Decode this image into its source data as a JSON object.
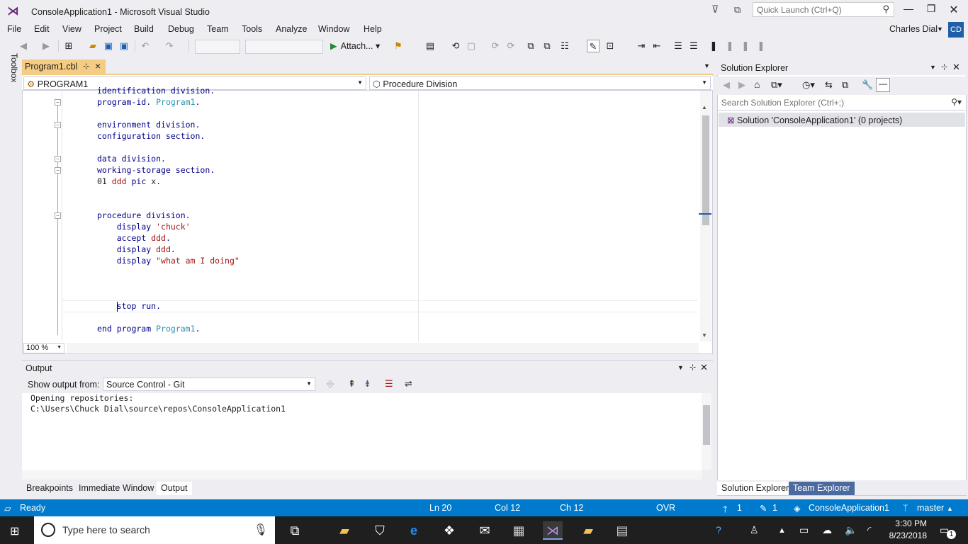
{
  "window": {
    "title": "ConsoleApplication1 - Microsoft Visual Studio",
    "quick_launch_placeholder": "Quick Launch (Ctrl+Q)",
    "user_name": "Charles Dial",
    "user_initials": "CD"
  },
  "menu": [
    "File",
    "Edit",
    "View",
    "Project",
    "Build",
    "Debug",
    "Team",
    "Tools",
    "Analyze",
    "Window",
    "Help"
  ],
  "toolbar": {
    "attach_label": "Attach..."
  },
  "toolbox_label": "Toolbox",
  "editor": {
    "tab_title": "Program1.cbl",
    "nav_left": "PROGRAM1",
    "nav_right": "Procedure Division",
    "zoom": "100 %",
    "lines": [
      {
        "parts": [
          [
            "kw",
            "identification division."
          ]
        ]
      },
      {
        "parts": [
          [
            "kw",
            "program-id. "
          ],
          [
            "id",
            "Program1"
          ],
          [
            "kw",
            "."
          ]
        ]
      },
      {
        "parts": []
      },
      {
        "parts": [
          [
            "kw",
            "environment division."
          ]
        ]
      },
      {
        "parts": [
          [
            "kw",
            "configuration section."
          ]
        ]
      },
      {
        "parts": []
      },
      {
        "parts": [
          [
            "kw",
            "data division."
          ]
        ]
      },
      {
        "parts": [
          [
            "kw",
            "working-storage section."
          ]
        ]
      },
      {
        "parts": [
          [
            "pl",
            "01 "
          ],
          [
            "tk",
            "ddd"
          ],
          [
            "kw",
            " pic "
          ],
          [
            "pl",
            "x."
          ]
        ]
      },
      {
        "parts": []
      },
      {
        "parts": []
      },
      {
        "parts": [
          [
            "kw",
            "procedure division."
          ]
        ]
      },
      {
        "parts": [
          [
            "pl",
            "    "
          ],
          [
            "kw",
            "display "
          ],
          [
            "tk",
            "'chuck'"
          ]
        ]
      },
      {
        "parts": [
          [
            "pl",
            "    "
          ],
          [
            "kw",
            "accept "
          ],
          [
            "tk",
            "ddd"
          ],
          [
            "kw",
            "."
          ]
        ]
      },
      {
        "parts": [
          [
            "pl",
            "    "
          ],
          [
            "kw",
            "display "
          ],
          [
            "tk",
            "ddd"
          ],
          [
            "kw",
            "."
          ]
        ]
      },
      {
        "parts": [
          [
            "pl",
            "    "
          ],
          [
            "kw",
            "display "
          ],
          [
            "tk",
            "\"what am I doing\""
          ]
        ]
      },
      {
        "parts": []
      },
      {
        "parts": []
      },
      {
        "parts": []
      },
      {
        "parts": [
          [
            "pl",
            "    "
          ],
          [
            "kw",
            "stop run."
          ]
        ]
      },
      {
        "parts": []
      },
      {
        "parts": [
          [
            "kw",
            "end program "
          ],
          [
            "id",
            "Program1"
          ],
          [
            "kw",
            "."
          ]
        ]
      }
    ]
  },
  "output": {
    "title": "Output",
    "show_from_label": "Show output from:",
    "source": "Source Control - Git",
    "text": "Opening repositories:\nC:\\Users\\Chuck Dial\\source\\repos\\ConsoleApplication1"
  },
  "bottom_tabs": [
    "Breakpoints",
    "Immediate Window",
    "Output"
  ],
  "solution_explorer": {
    "title": "Solution Explorer",
    "search_placeholder": "Search Solution Explorer (Ctrl+;)",
    "root": "Solution 'ConsoleApplication1' (0 projects)",
    "tabs": [
      "Solution Explorer",
      "Team Explorer"
    ]
  },
  "status": {
    "ready": "Ready",
    "ln": "Ln 20",
    "col": "Col 12",
    "ch": "Ch 12",
    "ovr": "OVR",
    "up_count": "1",
    "edit_count": "1",
    "repo": "ConsoleApplication1",
    "branch": "master"
  },
  "taskbar": {
    "search_placeholder": "Type here to search",
    "time": "3:30 PM",
    "date": "8/23/2018",
    "notif_count": "1"
  },
  "colors": {
    "accent": "#007acc",
    "tab_active": "#f5cc84",
    "keyword": "#00008b",
    "identifier": "#2b91af",
    "token": "#a31515"
  }
}
